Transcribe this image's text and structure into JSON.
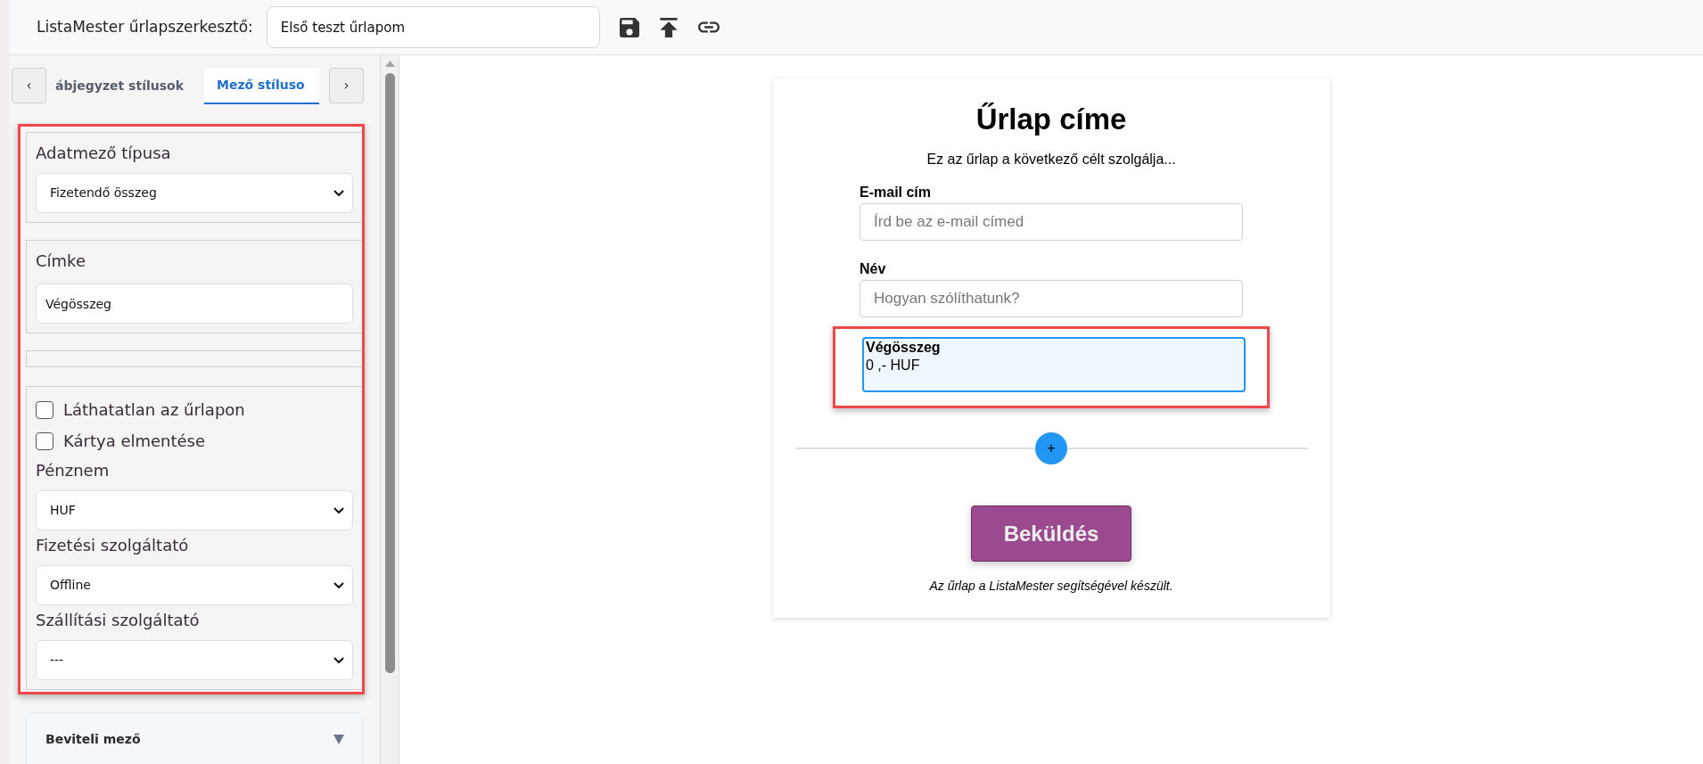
{
  "header": {
    "title": "ListaMester űrlapszerkesztő:",
    "form_name": "Első teszt űrlapom"
  },
  "sidebar": {
    "tab_prev": "‹",
    "tab_next": "›",
    "tabs": [
      {
        "label": "ábjegyzet stílusok",
        "selected": false
      },
      {
        "label": "Mező stíluso",
        "selected": true
      }
    ],
    "settings": {
      "highlighted": true,
      "sections": [
        {
          "kind": "group",
          "items": [
            {
              "kind": "select",
              "label": "Adatmező típusa",
              "value": "Fizetendő összeg"
            }
          ]
        },
        {
          "kind": "group",
          "items": [
            {
              "kind": "input",
              "label": "Címke",
              "value": "Végösszeg"
            }
          ]
        },
        {
          "kind": "empty"
        },
        {
          "kind": "group",
          "items": [
            {
              "kind": "checkbox",
              "label": "Láthatatlan az űrlapon",
              "checked": false
            },
            {
              "kind": "checkbox",
              "label": "Kártya elmentése",
              "checked": false
            },
            {
              "kind": "select",
              "label": "Pénznem",
              "value": "HUF"
            },
            {
              "kind": "select",
              "label": "Fizetési szolgáltató",
              "value": "Offline"
            },
            {
              "kind": "select",
              "label": "Szállítási szolgáltató",
              "value": "---"
            }
          ]
        }
      ]
    },
    "panels": [
      {
        "label": "Beviteli mező",
        "expanded": false
      }
    ]
  },
  "form": {
    "title": "Űrlap címe",
    "description": "Ez az űrlap a következő célt szolgálja...",
    "fields": [
      {
        "kind": "email",
        "label": "E-mail cím",
        "placeholder": "Írd be az e-mail címed",
        "selected": false
      },
      {
        "kind": "text",
        "label": "Név",
        "placeholder": "Hogyan szólíthatunk?",
        "selected": false
      },
      {
        "kind": "payment",
        "label": "Végösszeg",
        "value": "0 ,- HUF",
        "selected": true
      }
    ],
    "add_button": "+",
    "submit": "Beküldés",
    "footer": "Az űrlap a ListaMester segítségével készült."
  }
}
